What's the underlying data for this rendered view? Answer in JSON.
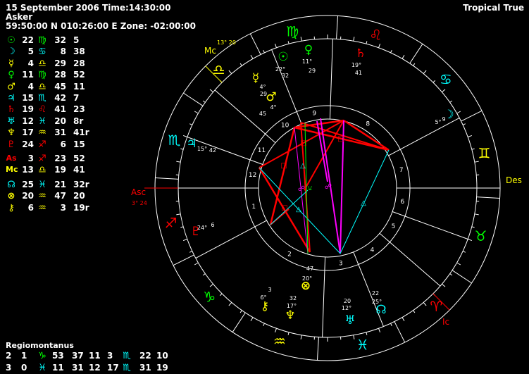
{
  "header": {
    "date_time": "15 September 2006  Time:14:30:00",
    "asker": "Asker",
    "location": "59:50:00 N 010:26:00 E  Zone: -02:00:00",
    "mode": "Tropical True"
  },
  "colors": {
    "background": "#000000",
    "sun": "#00ff00",
    "moon": "#00ffff",
    "mercury": "#ffff00",
    "venus": "#00ff00",
    "mars": "#ffff00",
    "jupiter": "#00ffff",
    "saturn": "#ff0000",
    "uranus": "#00ffff",
    "neptune": "#ffff00",
    "pluto": "#ff0000",
    "angle": "#ff0000",
    "fire": "#ff0000",
    "earth": "#00ff00",
    "air": "#ffff00",
    "water": "#00ffff",
    "square_aspect": "#ff0000",
    "opposition_aspect": "#ff00ff",
    "trine_aspect": "#00ffff"
  },
  "positions": [
    {
      "glyph": "☉",
      "glyph_name": "sun-icon",
      "color": "#00ff00",
      "deg": "22",
      "sign": "♍",
      "sign_name": "virgo-icon",
      "sign_color": "#00ff00",
      "min": "32",
      "rest": "5"
    },
    {
      "glyph": "☽",
      "glyph_name": "moon-icon",
      "color": "#00ffff",
      "deg": "5",
      "sign": "♋",
      "sign_name": "cancer-icon",
      "sign_color": "#00ffff",
      "min": "8",
      "rest": "38"
    },
    {
      "glyph": "☿",
      "glyph_name": "mercury-icon",
      "color": "#ffff00",
      "deg": "4",
      "sign": "♎",
      "sign_name": "libra-icon",
      "sign_color": "#ffff00",
      "min": "29",
      "rest": "28"
    },
    {
      "glyph": "♀",
      "glyph_name": "venus-icon",
      "color": "#00ff00",
      "deg": "11",
      "sign": "♍",
      "sign_name": "virgo-icon",
      "sign_color": "#00ff00",
      "min": "28",
      "rest": "52"
    },
    {
      "glyph": "♂",
      "glyph_name": "mars-icon",
      "color": "#ffff00",
      "deg": "4",
      "sign": "♎",
      "sign_name": "libra-icon",
      "sign_color": "#ffff00",
      "min": "45",
      "rest": "11"
    },
    {
      "glyph": "♃",
      "glyph_name": "jupiter-icon",
      "color": "#00ffff",
      "deg": "15",
      "sign": "♏",
      "sign_name": "scorpio-icon",
      "sign_color": "#00ffff",
      "min": "42",
      "rest": "7"
    },
    {
      "glyph": "♄",
      "glyph_name": "saturn-icon",
      "color": "#ff0000",
      "deg": "19",
      "sign": "♌",
      "sign_name": "leo-icon",
      "sign_color": "#ff0000",
      "min": "41",
      "rest": "23"
    },
    {
      "glyph": "♅",
      "glyph_name": "uranus-icon",
      "color": "#00ffff",
      "deg": "12",
      "sign": "♓",
      "sign_name": "pisces-icon",
      "sign_color": "#00ffff",
      "min": "20",
      "rest": "8r"
    },
    {
      "glyph": "♆",
      "glyph_name": "neptune-icon",
      "color": "#ffff00",
      "deg": "17",
      "sign": "♒",
      "sign_name": "aquarius-icon",
      "sign_color": "#ffff00",
      "min": "31",
      "rest": "41r"
    },
    {
      "glyph": "♇",
      "glyph_name": "pluto-icon",
      "color": "#ff0000",
      "deg": "24",
      "sign": "♐",
      "sign_name": "sagittarius-icon",
      "sign_color": "#ff0000",
      "min": "6",
      "rest": "15"
    },
    {
      "glyph": "As",
      "glyph_name": "ascendant-icon",
      "color": "#ff0000",
      "deg": "3",
      "sign": "♐",
      "sign_name": "sagittarius-icon",
      "sign_color": "#ff0000",
      "min": "23",
      "rest": "52"
    },
    {
      "glyph": "Mc",
      "glyph_name": "midheaven-icon",
      "color": "#ffff00",
      "deg": "13",
      "sign": "♎",
      "sign_name": "libra-icon",
      "sign_color": "#ffff00",
      "min": "19",
      "rest": "41"
    },
    {
      "glyph": "☊",
      "glyph_name": "north-node-icon",
      "color": "#00ffff",
      "deg": "25",
      "sign": "♓",
      "sign_name": "pisces-icon",
      "sign_color": "#00ffff",
      "min": "21",
      "rest": "32r"
    },
    {
      "glyph": "⊗",
      "glyph_name": "part-of-fortune-icon",
      "color": "#ffff00",
      "deg": "20",
      "sign": "♒",
      "sign_name": "aquarius-icon",
      "sign_color": "#ffff00",
      "min": "47",
      "rest": "20"
    },
    {
      "glyph": "⚷",
      "glyph_name": "chiron-icon",
      "color": "#ffff00",
      "deg": "6",
      "sign": "♒",
      "sign_name": "aquarius-icon",
      "sign_color": "#ffff00",
      "min": "3",
      "rest": "19r"
    }
  ],
  "houses": {
    "system": "Regiomontanus",
    "rows": [
      {
        "h1": "2",
        "d1": "1",
        "s1": "♑",
        "s1_name": "capricorn-icon",
        "s1_color": "#00ff00",
        "m1": "53",
        "h2": "37",
        "d2": "11",
        "h3": "3",
        "s2": "♏",
        "s2_name": "scorpio-icon",
        "s2_color": "#00ffff",
        "d3": "22",
        "m3": "10"
      },
      {
        "h1": "3",
        "d1": "0",
        "s1": "♓",
        "s1_name": "pisces-icon",
        "s1_color": "#00ffff",
        "m1": "11",
        "h2": "31",
        "d2": "12",
        "h3": "17",
        "s2": "♏",
        "s2_name": "scorpio-icon",
        "s2_color": "#00ffff",
        "d3": "31",
        "m3": "19"
      }
    ]
  },
  "wheel": {
    "zodiac_signs": [
      {
        "glyph": "♍",
        "name": "virgo-icon",
        "color": "#00ff00"
      },
      {
        "glyph": "♌",
        "name": "leo-icon",
        "color": "#ff0000"
      },
      {
        "glyph": "♋",
        "name": "cancer-icon",
        "color": "#00ffff"
      },
      {
        "glyph": "♊",
        "name": "gemini-icon",
        "color": "#ffff00"
      },
      {
        "glyph": "♉",
        "name": "taurus-icon",
        "color": "#00ff00"
      },
      {
        "glyph": "♈",
        "name": "aries-icon",
        "color": "#ff0000"
      },
      {
        "glyph": "♓",
        "name": "pisces-icon",
        "color": "#00ffff"
      },
      {
        "glyph": "♒",
        "name": "aquarius-icon",
        "color": "#ffff00"
      },
      {
        "glyph": "♑",
        "name": "capricorn-icon",
        "color": "#00ff00"
      },
      {
        "glyph": "♐",
        "name": "sagittarius-icon",
        "color": "#ff0000"
      },
      {
        "glyph": "♏",
        "name": "scorpio-icon",
        "color": "#00ffff"
      },
      {
        "glyph": "♎",
        "name": "libra-icon",
        "color": "#ffff00"
      }
    ],
    "house_numbers": [
      "1",
      "2",
      "3",
      "4",
      "5",
      "6",
      "7",
      "8",
      "9",
      "10",
      "11",
      "12"
    ],
    "angles": {
      "asc_label": "Asc",
      "asc_pos": "3° 24",
      "mc_label": "Mc",
      "mc_pos": "13° 20",
      "des_label": "Des",
      "ic_label": "Ic"
    },
    "planets": [
      {
        "name": "sun-icon",
        "glyph": "☉",
        "color": "#00ff00",
        "deg": "22°",
        "min": "32"
      },
      {
        "name": "venus-icon",
        "glyph": "♀",
        "color": "#00ff00",
        "deg": "11°",
        "min": "29"
      },
      {
        "name": "saturn-icon",
        "glyph": "♄",
        "color": "#ff0000",
        "deg": "19°",
        "min": "41"
      },
      {
        "name": "mercury-icon",
        "glyph": "☿",
        "color": "#ffff00",
        "deg": "4°",
        "min": "29"
      },
      {
        "name": "mars-icon",
        "glyph": "♂",
        "color": "#ffff00",
        "deg": "4°",
        "min": "45"
      },
      {
        "name": "moon-icon",
        "glyph": "☽",
        "color": "#00ffff",
        "deg": "5°",
        "min": "9"
      },
      {
        "name": "jupiter-icon",
        "glyph": "♃",
        "color": "#00ffff",
        "deg": "15°",
        "min": "42"
      },
      {
        "name": "pluto-icon",
        "glyph": "♇",
        "color": "#ff0000",
        "deg": "24°",
        "min": "6"
      },
      {
        "name": "chiron-icon",
        "glyph": "⚷",
        "color": "#ffff00",
        "deg": "6°",
        "min": "3"
      },
      {
        "name": "part-of-fortune-icon",
        "glyph": "⊗",
        "color": "#ffff00",
        "deg": "20°",
        "min": "47"
      },
      {
        "name": "neptune-icon",
        "glyph": "♆",
        "color": "#ffff00",
        "deg": "17°",
        "min": "32"
      },
      {
        "name": "uranus-icon",
        "glyph": "♅",
        "color": "#00ffff",
        "deg": "12°",
        "min": "20"
      },
      {
        "name": "north-node-icon",
        "glyph": "☊",
        "color": "#00ffff",
        "deg": "25°",
        "min": "22"
      }
    ]
  }
}
